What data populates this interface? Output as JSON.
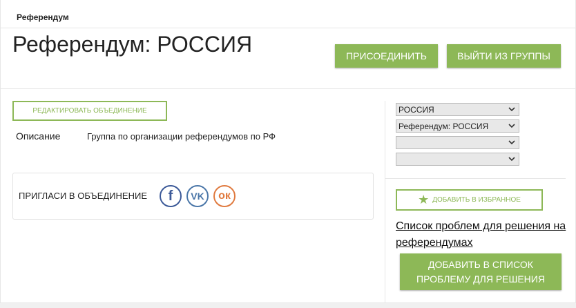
{
  "breadcrumb": "Референдум",
  "title": "Референдум: РОССИЯ",
  "buttons": {
    "join": "ПРИСОЕДИНИТЬ",
    "leave": "ВЫЙТИ ИЗ ГРУППЫ",
    "edit": "РЕДАКТИРОВАТЬ ОБЪЕДИНЕНИЕ",
    "favorite": "ДОБАВИТЬ В ИЗБРАННОЕ",
    "add_problem": "ДОБАВИТЬ В СПИСОК ПРОБЛЕМУ ДЛЯ РЕШЕНИЯ"
  },
  "description": {
    "label": "Описание",
    "value": "Группа по организации референдумов по РФ"
  },
  "invite": {
    "label": "ПРИГЛАСИ В ОБЪЕДИНЕНИЕ",
    "icons": [
      "facebook-icon",
      "vk-icon",
      "odnoklassniki-icon"
    ],
    "fb_glyph": "f",
    "vk_glyph": "VK",
    "ok_glyph": "ок"
  },
  "selects": [
    {
      "value": "РОССИЯ"
    },
    {
      "value": "Референдум: РОССИЯ"
    },
    {
      "value": ""
    },
    {
      "value": ""
    }
  ],
  "problems_link": "Список проблем для решения на референдумах",
  "colors": {
    "accent": "#8db857",
    "facebook": "#3b5998",
    "vk": "#4a76a8",
    "odnoklassniki": "#e07a3f"
  }
}
